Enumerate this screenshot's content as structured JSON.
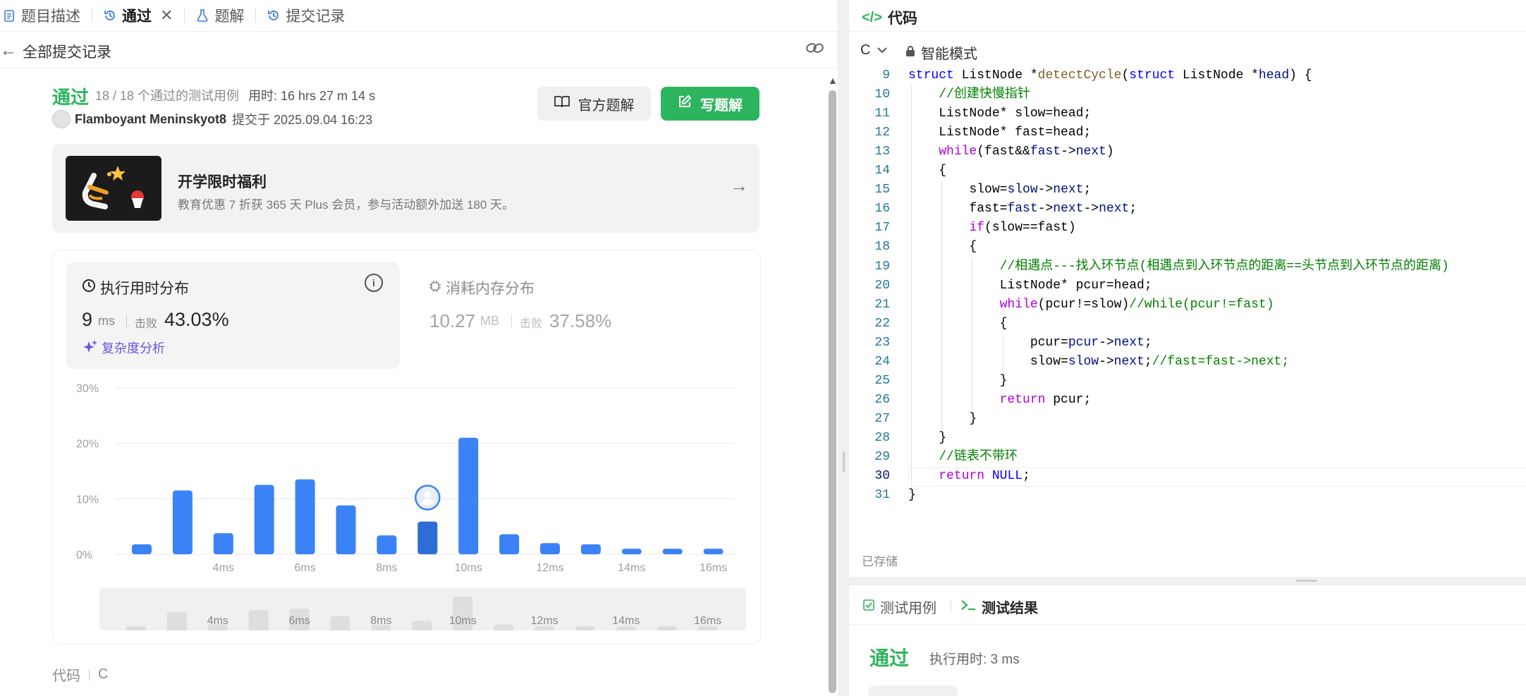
{
  "left_tabs": [
    {
      "label": "题目描述",
      "icon": "document-icon"
    },
    {
      "label": "通过",
      "icon": "history-icon",
      "active": true
    },
    {
      "label": "题解",
      "icon": "flask-icon"
    },
    {
      "label": "提交记录",
      "icon": "history-icon"
    }
  ],
  "subbar": {
    "title": "全部提交记录"
  },
  "submission": {
    "status": "通过",
    "testcases": "18 / 18 个通过的测试用例",
    "runtime": "用时: 16 hrs 27 m 14 s",
    "author": "Flamboyant Meninskyot8",
    "submitted": "提交于 2025.09.04 16:23"
  },
  "buttons": {
    "official": "官方题解",
    "write": "写题解"
  },
  "promo": {
    "title": "开学限时福利",
    "desc": "教育优惠 7 折获 365 天 Plus 会员，参与活动额外加送 180 天。"
  },
  "runtime_stats": {
    "title": "执行用时分布",
    "value": "9",
    "unit": "ms",
    "beat_label": "击败",
    "beat": "43.03%",
    "complexity": "复杂度分析"
  },
  "memory_stats": {
    "title": "消耗内存分布",
    "value": "10.27",
    "unit": "MB",
    "beat_label": "击败",
    "beat": "37.58%"
  },
  "chart_data": {
    "type": "bar",
    "x": [
      2,
      3,
      4,
      5,
      6,
      7,
      8,
      9,
      10,
      11,
      12,
      13,
      14,
      15,
      16
    ],
    "values": [
      1.8,
      11.5,
      3.8,
      12.5,
      13.5,
      8.8,
      3.4,
      5.9,
      21.0,
      3.6,
      2.0,
      1.8,
      1.0,
      1.0,
      1.0
    ],
    "highlight_index": 7,
    "yticks": [
      "0%",
      "10%",
      "20%",
      "30%"
    ],
    "ylim": [
      0,
      30
    ],
    "xticks": [
      "4ms",
      "6ms",
      "8ms",
      "10ms",
      "12ms",
      "14ms",
      "16ms"
    ],
    "xtick_values": [
      4,
      6,
      8,
      10,
      12,
      14,
      16
    ],
    "colors": {
      "bar": "#3b82f6",
      "highlight": "#2e6dd6"
    }
  },
  "mini_chart": {
    "xticks": [
      "4ms",
      "6ms",
      "8ms",
      "10ms",
      "12ms",
      "14ms",
      "16ms"
    ],
    "values": [
      1.8,
      11.5,
      3.8,
      12.5,
      13.5,
      8.8,
      3.4,
      5.9,
      21.0,
      3.6,
      2.0,
      1.8,
      1.0,
      1.0,
      1.0
    ]
  },
  "code_section": {
    "label": "代码",
    "lang": "C"
  },
  "editor": {
    "title": "代码",
    "lang": "C",
    "mode": "智能模式",
    "saved": "已存储"
  },
  "code_lines": [
    {
      "n": "9",
      "t": "struct ListNode *detectCycle(struct ListNode *head) {"
    },
    {
      "n": "10",
      "t": "    //创建快慢指针"
    },
    {
      "n": "11",
      "t": "    ListNode* slow=head;"
    },
    {
      "n": "12",
      "t": "    ListNode* fast=head;"
    },
    {
      "n": "13",
      "t": "    while(fast&&fast->next)"
    },
    {
      "n": "14",
      "t": "    {"
    },
    {
      "n": "15",
      "t": "        slow=slow->next;"
    },
    {
      "n": "16",
      "t": "        fast=fast->next->next;"
    },
    {
      "n": "17",
      "t": "        if(slow==fast)"
    },
    {
      "n": "18",
      "t": "        {"
    },
    {
      "n": "19",
      "t": "            //相遇点---找入环节点(相遇点到入环节点的距离==头节点到入环节点的距离)"
    },
    {
      "n": "20",
      "t": "            ListNode* pcur=head;"
    },
    {
      "n": "21",
      "t": "            while(pcur!=slow)//while(pcur!=fast)"
    },
    {
      "n": "22",
      "t": "            {"
    },
    {
      "n": "23",
      "t": "                pcur=pcur->next;"
    },
    {
      "n": "24",
      "t": "                slow=slow->next;//fast=fast->next;"
    },
    {
      "n": "25",
      "t": "            }"
    },
    {
      "n": "26",
      "t": "            return pcur;"
    },
    {
      "n": "27",
      "t": "        }"
    },
    {
      "n": "28",
      "t": "    }"
    },
    {
      "n": "29",
      "t": "    //链表不带环"
    },
    {
      "n": "30",
      "t": "    return NULL;"
    },
    {
      "n": "31",
      "t": "}"
    }
  ],
  "results": {
    "tab_testcase": "测试用例",
    "tab_result": "测试结果",
    "status": "通过",
    "time": "执行用时: 3 ms"
  }
}
